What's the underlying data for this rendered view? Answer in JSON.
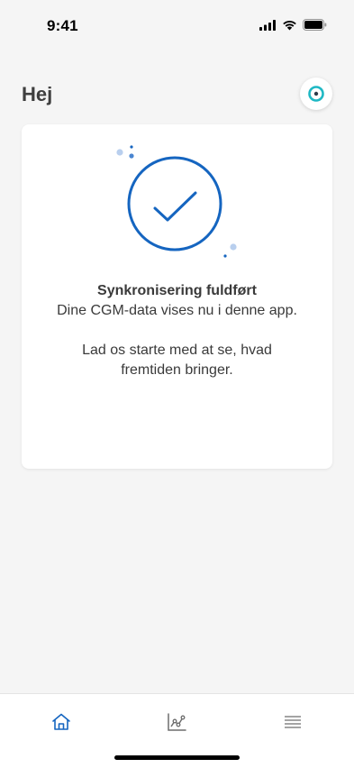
{
  "status_bar": {
    "time": "9:41"
  },
  "header": {
    "greeting": "Hej"
  },
  "card": {
    "title": "Synkronisering fuldført",
    "subtitle": "Dine CGM-data vises nu i denne app.",
    "message": "Lad os starte med at se, hvad fremtiden bringer."
  },
  "tab_bar": {
    "tabs": [
      {
        "icon": "home-icon",
        "active": true
      },
      {
        "icon": "chart-icon",
        "active": false
      },
      {
        "icon": "menu-icon",
        "active": false
      }
    ]
  },
  "colors": {
    "accent": "#1565c0",
    "teal": "#1fb8c4",
    "background": "#f5f5f5",
    "text": "#3a3a3a"
  }
}
